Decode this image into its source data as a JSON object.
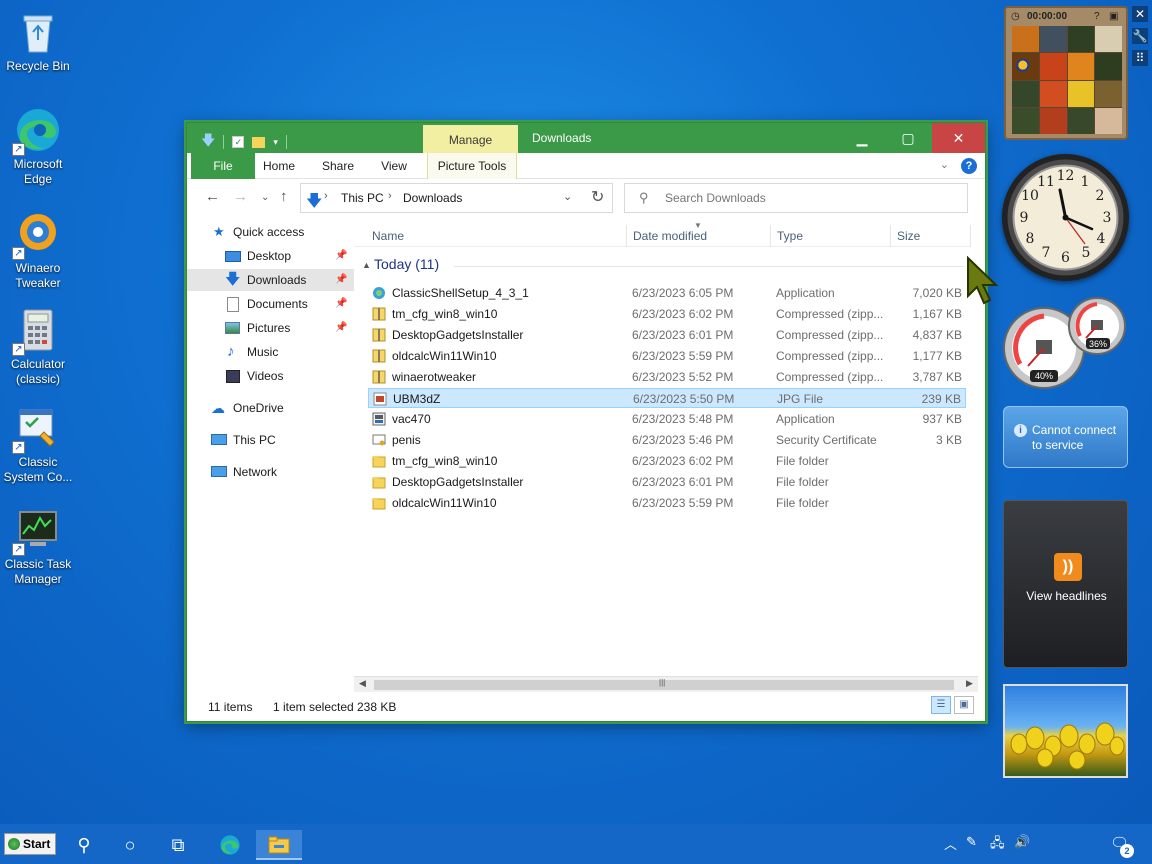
{
  "desktop_icons": [
    {
      "label": "Recycle Bin",
      "icon": "recycle-bin-icon"
    },
    {
      "label": "Microsoft Edge",
      "icon": "edge-icon"
    },
    {
      "label": "Winaero Tweaker",
      "icon": "winaero-tweaker-icon"
    },
    {
      "label": "Calculator (classic)",
      "icon": "calculator-icon"
    },
    {
      "label": "Classic System Co...",
      "icon": "system-config-icon"
    },
    {
      "label": "Classic Task Manager",
      "icon": "task-manager-icon"
    }
  ],
  "window": {
    "title": "Downloads",
    "manage_tab": "Manage",
    "accent": "#3a9a48",
    "close_color": "#c94545"
  },
  "ribbon": {
    "tabs": [
      "File",
      "Home",
      "Share",
      "View",
      "Picture Tools"
    ]
  },
  "address": {
    "crumbs": [
      "This PC",
      "Downloads"
    ]
  },
  "search": {
    "placeholder": "Search Downloads"
  },
  "navpane": {
    "items": [
      {
        "label": "Quick access",
        "icon": "star-icon"
      },
      {
        "label": "Desktop",
        "icon": "desktop-icon",
        "pinned": true
      },
      {
        "label": "Downloads",
        "icon": "download-icon",
        "pinned": true,
        "selected": true
      },
      {
        "label": "Documents",
        "icon": "documents-icon",
        "pinned": true
      },
      {
        "label": "Pictures",
        "icon": "pictures-icon",
        "pinned": true
      },
      {
        "label": "Music",
        "icon": "music-icon"
      },
      {
        "label": "Videos",
        "icon": "videos-icon"
      },
      {
        "label": "OneDrive",
        "icon": "onedrive-icon"
      },
      {
        "label": "This PC",
        "icon": "this-pc-icon"
      },
      {
        "label": "Network",
        "icon": "network-icon"
      }
    ]
  },
  "columns": [
    "Name",
    "Date modified",
    "Type",
    "Size"
  ],
  "group": {
    "label": "Today (11)"
  },
  "files": [
    {
      "name": "ClassicShellSetup_4_3_1",
      "date": "6/23/2023 6:05 PM",
      "type": "Application",
      "size": "7,020 KB",
      "icon": "setup-icon"
    },
    {
      "name": "tm_cfg_win8_win10",
      "date": "6/23/2023 6:02 PM",
      "type": "Compressed (zipp...",
      "size": "1,167 KB",
      "icon": "zip-icon"
    },
    {
      "name": "DesktopGadgetsInstaller",
      "date": "6/23/2023 6:01 PM",
      "type": "Compressed (zipp...",
      "size": "4,837 KB",
      "icon": "zip-icon"
    },
    {
      "name": "oldcalcWin11Win10",
      "date": "6/23/2023 5:59 PM",
      "type": "Compressed (zipp...",
      "size": "1,177 KB",
      "icon": "zip-icon"
    },
    {
      "name": "winaerotweaker",
      "date": "6/23/2023 5:52 PM",
      "type": "Compressed (zipp...",
      "size": "3,787 KB",
      "icon": "zip-icon"
    },
    {
      "name": "UBM3dZ",
      "date": "6/23/2023 5:50 PM",
      "type": "JPG File",
      "size": "239 KB",
      "icon": "jpg-icon",
      "selected": true
    },
    {
      "name": "vac470",
      "date": "6/23/2023 5:48 PM",
      "type": "Application",
      "size": "937 KB",
      "icon": "app-icon"
    },
    {
      "name": "penis",
      "date": "6/23/2023 5:46 PM",
      "type": "Security Certificate",
      "size": "3 KB",
      "icon": "certificate-icon"
    },
    {
      "name": "tm_cfg_win8_win10",
      "date": "6/23/2023 6:02 PM",
      "type": "File folder",
      "size": "",
      "icon": "folder-icon"
    },
    {
      "name": "DesktopGadgetsInstaller",
      "date": "6/23/2023 6:01 PM",
      "type": "File folder",
      "size": "",
      "icon": "folder-icon"
    },
    {
      "name": "oldcalcWin11Win10",
      "date": "6/23/2023 5:59 PM",
      "type": "File folder",
      "size": "",
      "icon": "folder-icon"
    }
  ],
  "status": {
    "count": "11 items",
    "selection": "1 item selected",
    "size": "238 KB"
  },
  "gadgets": {
    "puzzle_time": "00:00:00",
    "cpu_percent": "40%",
    "mem_percent": "36%",
    "weather_line1": "Cannot connect",
    "weather_line2": "to service",
    "feed_label": "View headlines"
  },
  "taskbar": {
    "start_label": "Start",
    "badge": "2"
  }
}
